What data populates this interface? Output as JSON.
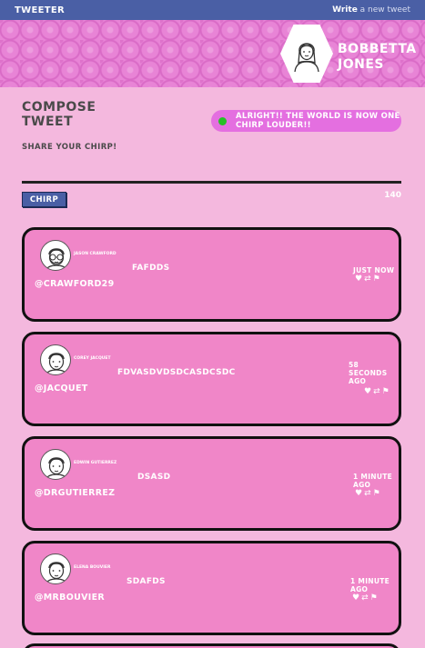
{
  "navbar": {
    "brand": "TWEETER",
    "write_bold": "Write",
    "write_rest": " a new tweet"
  },
  "profile": {
    "name": "BOBBETTA JONES",
    "avatar_icon": "user-avatar-icon"
  },
  "compose": {
    "title": "COMPOSE TWEET",
    "subtitle": "SHARE YOUR CHIRP!",
    "button_label": "CHIRP",
    "char_count": "140"
  },
  "banner": {
    "text": "ALRIGHT!! THE WORLD IS NOW ONE CHIRP LOUDER!!",
    "dot_color": "#26c026"
  },
  "actions": {
    "like_icon": "♥",
    "retweet_icon": "⇄",
    "flag_icon": "⚑"
  },
  "tweets": [
    {
      "name": "JASON CRAWFORD",
      "handle": "@CRAWFORD29",
      "text": "FAFDDS",
      "time": "JUST NOW"
    },
    {
      "name": "COREY JACQUET",
      "handle": "@JACQUET",
      "text": "FDVASDVDSDCASDCSDC",
      "time": "58 SECONDS AGO"
    },
    {
      "name": "EDWIN GUTIERREZ",
      "handle": "@DRGUTIERREZ",
      "text": "DSASD",
      "time": "1 MINUTE AGO"
    },
    {
      "name": "ELENA BOUVIER",
      "handle": "@MRBOUVIER",
      "text": "SDAFDS",
      "time": "1 MINUTE AGO"
    }
  ],
  "colors": {
    "page_bg": "#f4b8de",
    "navbar": "#4a5fa5",
    "card": "#f086c8",
    "banner": "#e46fe0"
  }
}
